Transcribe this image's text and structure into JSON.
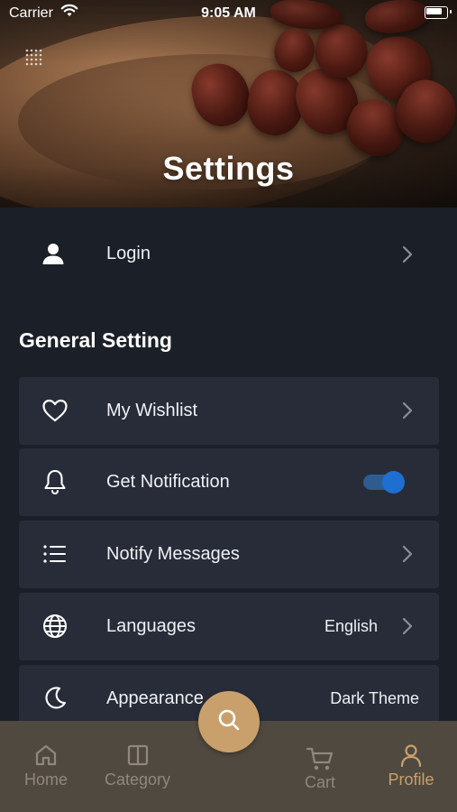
{
  "status_bar": {
    "carrier": "Carrier",
    "time": "9:05 AM"
  },
  "hero": {
    "title": "Settings"
  },
  "login": {
    "label": "Login",
    "icon": "person-icon"
  },
  "general_setting": {
    "title": "General Setting",
    "items": [
      {
        "label": "My Wishlist",
        "icon": "heart-icon",
        "control": "chevron"
      },
      {
        "label": "Get Notification",
        "icon": "bell-icon",
        "control": "toggle",
        "toggle_on": true
      },
      {
        "label": "Notify Messages",
        "icon": "list-icon",
        "control": "chevron"
      },
      {
        "label": "Languages",
        "icon": "globe-icon",
        "value": "English",
        "control": "chevron"
      },
      {
        "label": "Appearance",
        "icon": "moon-icon",
        "value": "Dark Theme",
        "control": "none"
      }
    ]
  },
  "tabbar": {
    "tabs": [
      {
        "label": "Home",
        "icon": "home-icon",
        "active": false
      },
      {
        "label": "Category",
        "icon": "category-icon",
        "active": false
      },
      {
        "label": "Cart",
        "icon": "cart-icon",
        "active": false
      },
      {
        "label": "Profile",
        "icon": "profile-icon",
        "active": true
      }
    ],
    "fab_icon": "search-icon"
  },
  "colors": {
    "background": "#1b1f27",
    "card": "#272c38",
    "accent": "#c9a06b",
    "toggle": "#1e6fd0",
    "tabbar": "#50493f"
  }
}
